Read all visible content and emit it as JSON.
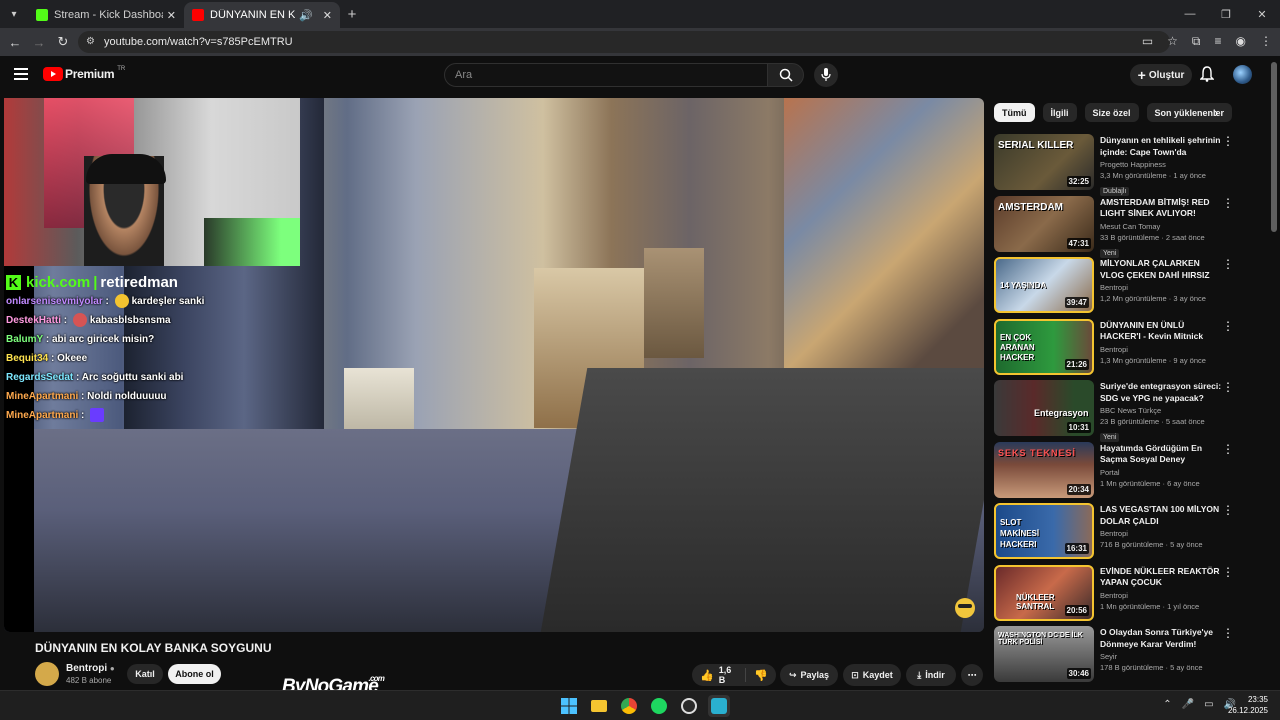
{
  "browser": {
    "tabs": [
      {
        "label": "Stream - Kick Dashboard",
        "favicon_color": "#53fc18"
      },
      {
        "label": "DÜNYANIN EN KOLAY BANK",
        "favicon_color": "#ff0000"
      }
    ],
    "url": "youtube.com/watch?v=s785PcEMTRU"
  },
  "youtube": {
    "logo_text": "Premium",
    "logo_cc": "TR",
    "search_placeholder": "Ara",
    "create_label": "Oluştur"
  },
  "stream": {
    "kick_label": "kick.com",
    "streamer": "retiredman",
    "chat": [
      {
        "user": "onlarsenisevmiyolar",
        "color": "#c089ff",
        "emote_color": "#f4c430",
        "msg": "kardeşler sanki"
      },
      {
        "user": "DestekHatti",
        "color": "#ff9ae0",
        "emote_color": "#d65454",
        "msg": "kabasblsbsnsma"
      },
      {
        "user": "BalumY",
        "color": "#7dff7d",
        "msg": "abi arc giricek misin?"
      },
      {
        "user": "Bequit34",
        "color": "#ffe34f",
        "msg": "Okeee"
      },
      {
        "user": "RegardsSedat",
        "color": "#7de8ff",
        "msg": "Arc soğuttu sanki abi"
      },
      {
        "user": "MineApartmani",
        "color": "#ffa94d",
        "msg": "Noldi nolduuuuu"
      },
      {
        "user": "MineApartmani",
        "color": "#ffa94d",
        "emote_color": "#6a3cff",
        "msg": ""
      }
    ]
  },
  "video": {
    "title": "DÜNYANIN EN KOLAY BANKA SOYGUNU",
    "channel": "Bentropi",
    "subscribers": "482 B abone",
    "join_label": "Katıl",
    "subscribe_label": "Abone ol",
    "likes": "1,6 B",
    "share_label": "Paylaş",
    "save_label": "Kaydet",
    "download_label": "İndir"
  },
  "watermark": {
    "text": "ByNoGame",
    "suffix": ".com"
  },
  "chips": [
    "Tümü",
    "İlgili",
    "Size özel",
    "Son yüklenenler"
  ],
  "recommendations": [
    {
      "title": "Dünyanın en tehlikeli şehrinin içinde: Cape Town'da yaşamak...",
      "channel": "Progetto Happiness",
      "views": "3,3 Mn görüntüleme",
      "age": "1 ay önce",
      "duration": "32:25",
      "badge": "Dublajlı",
      "thumb_text": "SERIAL KILLER",
      "thumb_bg": "#3a3a2a"
    },
    {
      "title": "AMSTERDAM BİTMİŞ! RED LIGHT SİNEK AVLIYOR!",
      "channel": "Mesut Can Tomay",
      "views": "33 B görüntüleme",
      "age": "2 saat önce",
      "duration": "47:31",
      "badge": "Yeni",
      "thumb_text": "AMSTERDAM",
      "thumb_bg": "#5a3b2a"
    },
    {
      "title": "MİLYONLAR ÇALARKEN VLOG ÇEKEN DAHİ HIRSIZ",
      "channel": "Bentropi",
      "views": "1,2 Mn görüntüleme",
      "age": "3 ay önce",
      "duration": "39:47",
      "badge": "",
      "thumb_text": "14 YAŞINDA",
      "thumb_bg": "#4b6a8a"
    },
    {
      "title": "DÜNYANIN EN ÜNLÜ HACKER'I - Kevin Mitnick",
      "channel": "Bentropi",
      "views": "1,3 Mn görüntüleme",
      "age": "9 ay önce",
      "duration": "21:26",
      "badge": "",
      "thumb_text": "EN ÇOK ARANAN HACKER",
      "thumb_bg": "#1e6a2e"
    },
    {
      "title": "Suriye'de entegrasyon süreci: SDG ve YPG ne yapacak?",
      "channel": "BBC News Türkçe",
      "views": "23 B görüntüleme",
      "age": "5 saat önce",
      "duration": "10:31",
      "badge": "Yeni",
      "thumb_text": "Entegrasyon",
      "thumb_bg": "#5a2a2a"
    },
    {
      "title": "Hayatımda Gördüğüm En Saçma Sosyal Deney",
      "channel": "Portal",
      "views": "1 Mn görüntüleme",
      "age": "6 ay önce",
      "duration": "20:34",
      "badge": "",
      "thumb_text": "SEKS TEKNESİ",
      "thumb_bg": "#7a4a3a"
    },
    {
      "title": "LAS VEGAS'TAN 100 MİLYON DOLAR ÇALDI",
      "channel": "Bentropi",
      "views": "716 B görüntüleme",
      "age": "5 ay önce",
      "duration": "16:31",
      "badge": "",
      "thumb_text": "SLOT MAKİNESİ HACKERI",
      "thumb_bg": "#1c4a8a"
    },
    {
      "title": "EVİNDE NÜKLEER REAKTÖR YAPAN ÇOCUK",
      "channel": "Bentropi",
      "views": "1 Mn görüntüleme",
      "age": "1 yıl önce",
      "duration": "20:56",
      "badge": "",
      "thumb_text": "NÜKLEER SANTRAL",
      "thumb_bg": "#6a2a2a"
    },
    {
      "title": "O Olaydan Sonra Türkiye'ye Dönmeye Karar Verdim!",
      "channel": "Seyir",
      "views": "178 B görüntüleme",
      "age": "5 ay önce",
      "duration": "30:46",
      "badge": "",
      "thumb_text": "WASHINGTON DC'DE İLK TÜRK POLİSİ",
      "thumb_bg": "#6a6a6a"
    }
  ],
  "clock": {
    "time": "23:35",
    "date": "26.12.2025"
  }
}
